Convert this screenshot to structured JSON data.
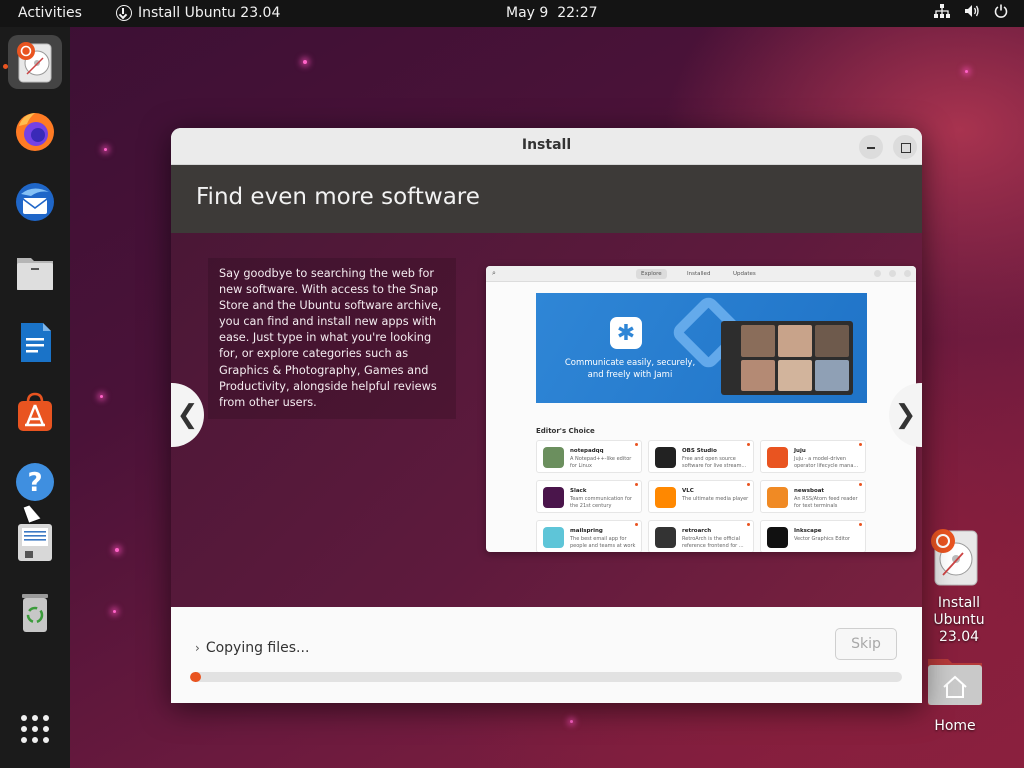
{
  "topbar": {
    "activities": "Activities",
    "app_menu": "Install Ubuntu 23.04",
    "date": "May 9",
    "time": "22:27",
    "tray_icons": [
      "network-icon",
      "volume-icon",
      "power-icon"
    ]
  },
  "dock": {
    "items": [
      {
        "name": "ubuntu-installer",
        "active": true
      },
      {
        "name": "firefox"
      },
      {
        "name": "thunderbird"
      },
      {
        "name": "files"
      },
      {
        "name": "libreoffice-writer"
      },
      {
        "name": "app-center"
      },
      {
        "name": "help"
      },
      {
        "name": "text-editor"
      },
      {
        "name": "trash"
      },
      {
        "name": "show-apps"
      }
    ]
  },
  "desktop": {
    "icons": [
      {
        "label": "Install Ubuntu 23.04"
      },
      {
        "label": "Home"
      }
    ]
  },
  "window": {
    "title": "Install",
    "slide": {
      "heading": "Find even more software",
      "body": "Say goodbye to searching the web for new software. With access to the Snap Store and the Ubuntu software archive, you can find and install new apps with ease. Just type in what you're looking for, or explore categories such as Graphics & Photography, Games and Productivity, alongside helpful reviews from other users.",
      "prev": "❮",
      "next": "❯"
    },
    "store_screenshot": {
      "tabs": [
        "Explore",
        "Installed",
        "Updates"
      ],
      "banner_text": "Communicate easily, securely, and freely with Jami",
      "section": "Editor's Choice",
      "apps": [
        {
          "name": "notepadqq",
          "desc": "A Notepad++-like editor for Linux",
          "color": "#6b8f5e"
        },
        {
          "name": "OBS Studio",
          "desc": "Free and open source software for live stream...",
          "color": "#222222"
        },
        {
          "name": "Juju",
          "desc": "Juju - a model-driven operator lifecycle mana...",
          "color": "#e95420"
        },
        {
          "name": "Slack",
          "desc": "Team communication for the 21st century",
          "color": "#4a154b"
        },
        {
          "name": "VLC",
          "desc": "The ultimate media player",
          "color": "#ff8800"
        },
        {
          "name": "newsboat",
          "desc": "An RSS/Atom feed reader for text terminals",
          "color": "#f08a24"
        },
        {
          "name": "mailspring",
          "desc": "The best email app for people and teams at work",
          "color": "#5ec5d8"
        },
        {
          "name": "retroarch",
          "desc": "RetroArch is the official reference frontend for ...",
          "color": "#333333"
        },
        {
          "name": "Inkscape",
          "desc": "Vector Graphics Editor",
          "color": "#111111"
        }
      ]
    },
    "status": "Copying files...",
    "skip": "Skip",
    "progress": 0.015
  },
  "colors": {
    "accent": "#e95420",
    "header_bg": "#3d3a38"
  }
}
